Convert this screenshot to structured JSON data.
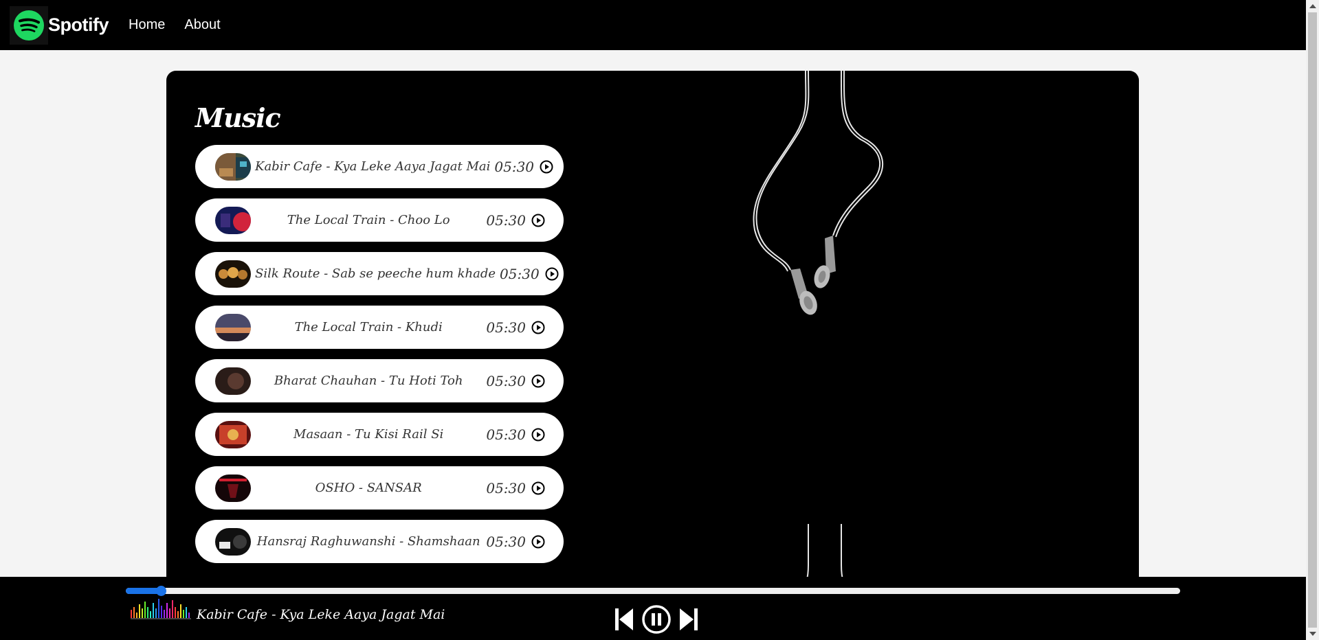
{
  "nav": {
    "brand": "Spotify",
    "links": [
      "Home",
      "About"
    ]
  },
  "main": {
    "heading": "Music",
    "songs": [
      {
        "name": "Kabir Cafe - Kya Leke Aaya Jagat Mai",
        "duration": "05:30"
      },
      {
        "name": "The Local Train - Choo Lo",
        "duration": "05:30"
      },
      {
        "name": "Silk Route - Sab se peeche hum khade",
        "duration": "05:30"
      },
      {
        "name": "The Local Train - Khudi",
        "duration": "05:30"
      },
      {
        "name": "Bharat Chauhan - Tu Hoti Toh",
        "duration": "05:30"
      },
      {
        "name": "Masaan - Tu Kisi Rail Si",
        "duration": "05:30"
      },
      {
        "name": "OSHO - SANSAR",
        "duration": "05:30"
      },
      {
        "name": "Hansraj Raghuwanshi - Shamshaan",
        "duration": "05:30"
      }
    ]
  },
  "player": {
    "now_playing": "Kabir Cafe - Kya Leke Aaya Jagat Mai",
    "progress_percent": 2,
    "state": "playing"
  },
  "colors": {
    "brand_green": "#1ed760",
    "progress": "#1a73e8"
  },
  "icons": {
    "play": "circle-play-icon",
    "pause": "circle-pause-icon",
    "previous": "skip-previous-icon",
    "next": "skip-next-icon"
  }
}
